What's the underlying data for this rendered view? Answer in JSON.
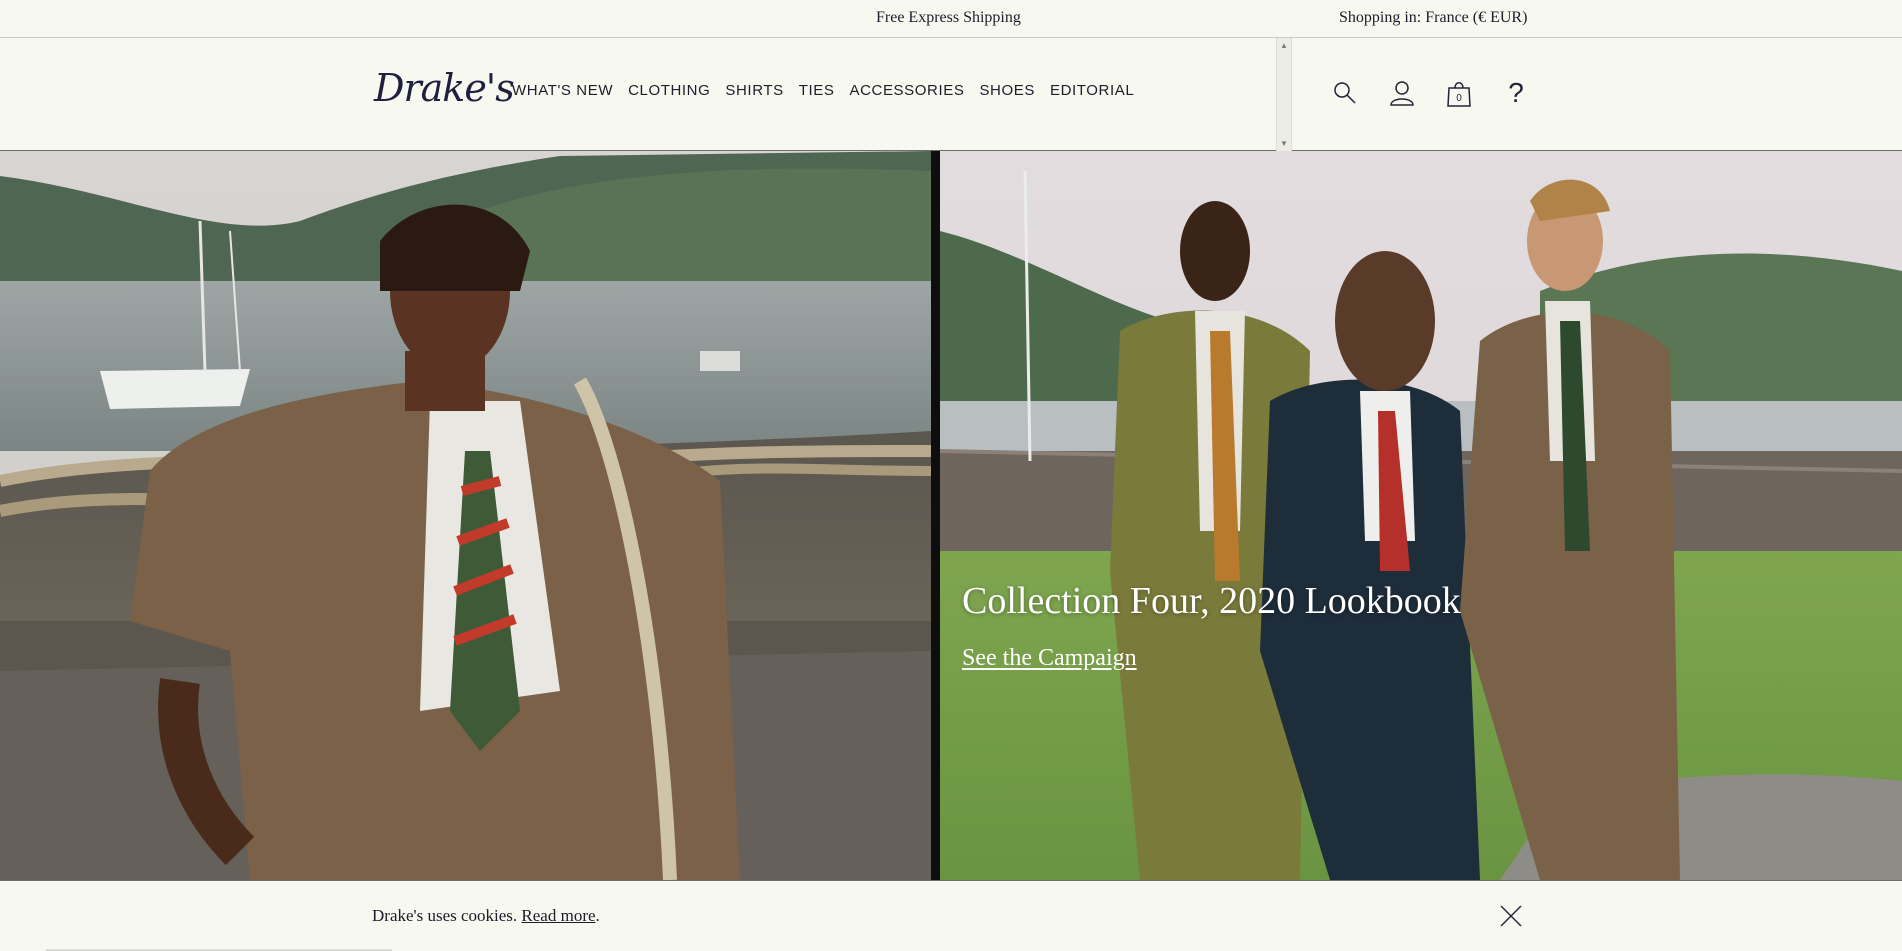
{
  "announcement": {
    "shipping": "Free Express Shipping",
    "region_label": "Shopping in:",
    "region_value": "France (€ EUR)"
  },
  "header": {
    "logo": "Drake's",
    "nav": [
      "WHAT'S NEW",
      "CLOTHING",
      "SHIRTS",
      "TIES",
      "ACCESSORIES",
      "SHOES",
      "EDITORIAL"
    ],
    "icons": [
      "search-icon",
      "account-icon",
      "bag-icon",
      "help-icon"
    ],
    "bag_count": "0",
    "help_glyph": "?"
  },
  "hero": {
    "title": "Collection Four, 2020 Lookbook",
    "link": "See the Campaign"
  },
  "cookie": {
    "text": "Drake's uses cookies.",
    "link": "Read more",
    "suffix": "."
  },
  "colors": {
    "background": "#f7f8f0",
    "text": "#1d1d2b",
    "divider": "#0e0e0e"
  }
}
